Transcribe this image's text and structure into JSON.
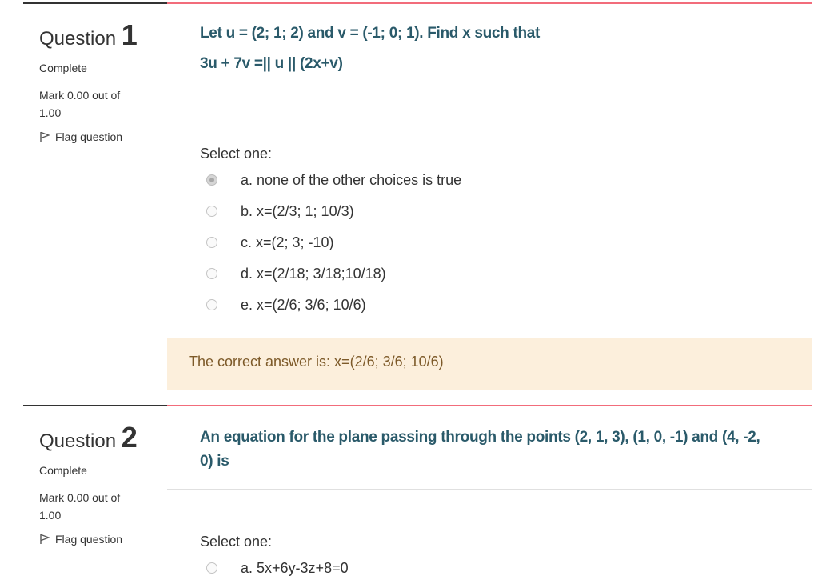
{
  "questions": [
    {
      "qno_prefix": "Question",
      "qno_num": "1",
      "state": "Complete",
      "grade": "Mark 0.00 out of 1.00",
      "flag_label": "Flag question",
      "text_line1": "Let u = (2; 1; 2) and v = (-1; 0; 1). Find x such that",
      "text_line2": "3u + 7v =|| u || (2x+v)",
      "prompt": "Select one:",
      "options": [
        {
          "label": "a. none of the other choices is true",
          "checked": true
        },
        {
          "label": "b. x=(2/3; 1; 10/3)",
          "checked": false
        },
        {
          "label": "c. x=(2; 3; -10)",
          "checked": false
        },
        {
          "label": "d. x=(2/18; 3/18;10/18)",
          "checked": false
        },
        {
          "label": "e. x=(2/6; 3/6; 10/6)",
          "checked": false
        }
      ],
      "feedback": "The correct answer is: x=(2/6; 3/6; 10/6)"
    },
    {
      "qno_prefix": "Question",
      "qno_num": "2",
      "state": "Complete",
      "grade": "Mark 0.00 out of 1.00",
      "flag_label": "Flag question",
      "text_line1": "An equation for the plane passing through the points (2, 1, 3), (1, 0, -1) and (4, -2,",
      "text_line2": "0) is",
      "prompt": "Select one:",
      "options": [
        {
          "label": "a. 5x+6y-3z+8=0",
          "checked": false
        }
      ]
    }
  ],
  "colors": {
    "accent_border": "#f26c7b",
    "question_text": "#2a5a6a",
    "feedback_bg": "#fcefdc",
    "feedback_text": "#7d5a29"
  }
}
